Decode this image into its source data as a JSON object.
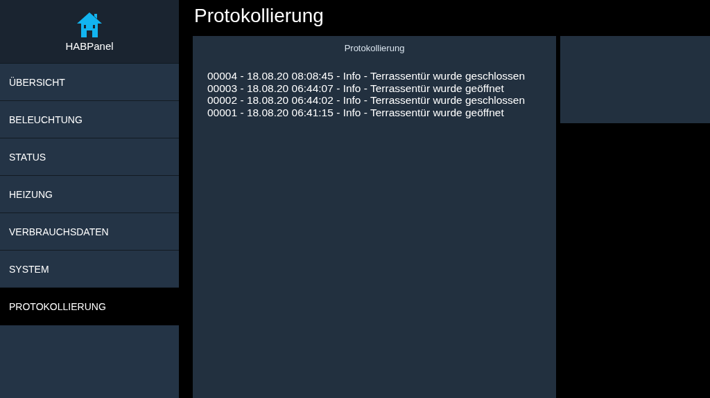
{
  "sidebar": {
    "brand": "HABPanel",
    "items": [
      {
        "label": "ÜBERSICHT",
        "selected": false
      },
      {
        "label": "BELEUCHTUNG",
        "selected": false
      },
      {
        "label": "STATUS",
        "selected": false
      },
      {
        "label": "HEIZUNG",
        "selected": false
      },
      {
        "label": "VERBRAUCHSDATEN",
        "selected": false
      },
      {
        "label": "SYSTEM",
        "selected": false
      },
      {
        "label": "PROTOKOLLIERUNG",
        "selected": true
      }
    ]
  },
  "page_title": "Protokollierung",
  "log_widget": {
    "title": "Protokollierung",
    "lines": [
      "00004 - 18.08.20 08:08:45 - Info - Terrassentür wurde geschlossen",
      "00003 - 18.08.20 06:44:07 - Info - Terrassentür wurde geöffnet",
      "00002 - 18.08.20 06:44:02 - Info - Terrassentür wurde geschlossen",
      "00001 - 18.08.20 06:41:15 - Info - Terrassentür wurde geöffnet"
    ]
  }
}
